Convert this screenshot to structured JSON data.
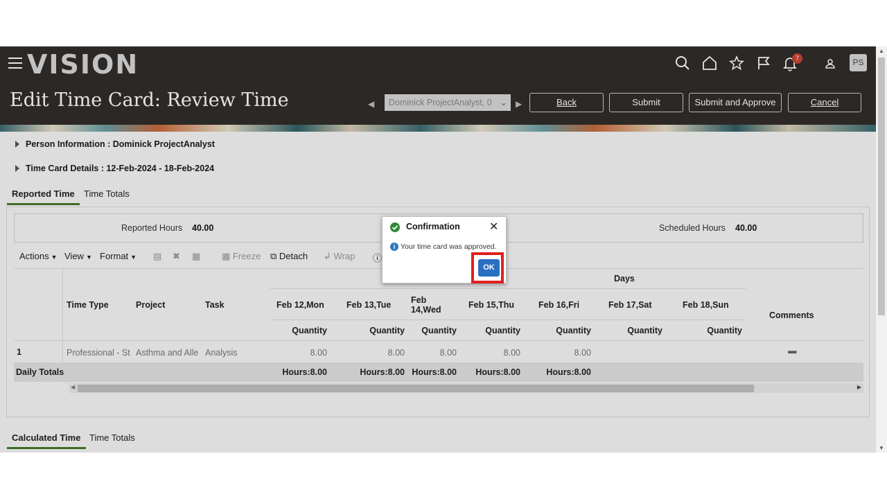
{
  "header": {
    "logo": "vision",
    "page_title": "Edit Time Card: Review Time",
    "notification_count": "7",
    "avatar_initials": "PS",
    "person_select_value": "Dominick ProjectAnalyst, 0",
    "buttons": {
      "back": "Back",
      "submit": "Submit",
      "submit_approve": "Submit and Approve",
      "cancel": "Cancel"
    }
  },
  "sections": {
    "person_info": "Person Information : Dominick ProjectAnalyst",
    "time_card_details": "Time Card Details : 12-Feb-2024 - 18-Feb-2024"
  },
  "tabs_top": [
    "Reported Time",
    "Time Totals"
  ],
  "tabs_bottom": [
    "Calculated Time",
    "Time Totals"
  ],
  "hours": {
    "reported_label": "Reported Hours",
    "reported_value": "40.00",
    "scheduled_label": "Scheduled Hours",
    "scheduled_value": "40.00"
  },
  "toolbar": {
    "actions": "Actions",
    "view": "View",
    "format": "Format",
    "freeze": "Freeze",
    "detach": "Detach",
    "wrap": "Wrap"
  },
  "table": {
    "days_header": "Days",
    "columns": [
      "Time Type",
      "Project",
      "Task"
    ],
    "days": [
      "Feb 12,Mon",
      "Feb 13,Tue",
      "Feb 14,Wed",
      "Feb 15,Thu",
      "Feb 16,Fri",
      "Feb 17,Sat",
      "Feb 18,Sun"
    ],
    "quantity_label": "Quantity",
    "comments_header": "Comments",
    "row": {
      "num": "1",
      "time_type": "Professional - St",
      "project": "Asthma and Alle",
      "task": "Analysis",
      "values": [
        "8.00",
        "8.00",
        "8.00",
        "8.00",
        "8.00",
        "",
        ""
      ]
    },
    "totals_label": "Daily Totals",
    "totals": [
      "Hours:8.00",
      "Hours:8.00",
      "Hours:8.00",
      "Hours:8.00",
      "Hours:8.00",
      "",
      ""
    ]
  },
  "dialog": {
    "title": "Confirmation",
    "message": "Your time card was approved.",
    "ok": "OK",
    "close": "✕"
  }
}
